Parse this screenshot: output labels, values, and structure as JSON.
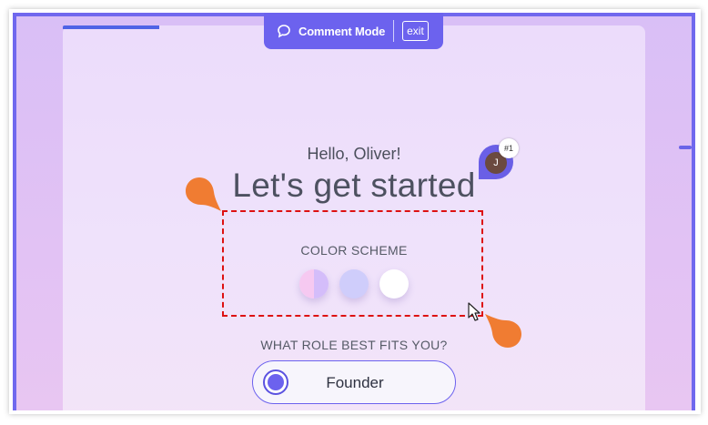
{
  "comment_bar": {
    "label": "Comment Mode",
    "exit_label": "exit",
    "icon": "comment-bubble-icon"
  },
  "onboarding": {
    "greeting": "Hello, Oliver!",
    "headline": "Let's get started",
    "color_scheme": {
      "label": "COLOR SCHEME",
      "options": [
        "pink-lavender",
        "periwinkle",
        "white"
      ]
    },
    "role": {
      "label": "WHAT ROLE BEST FITS YOU?",
      "selected_option": "Founder"
    }
  },
  "comment_pin": {
    "avatar_initial": "J",
    "number": "#1"
  },
  "colors": {
    "accent": "#6c62ee",
    "annotation_pin": "#f07c32",
    "selection_outline": "#dd1111"
  }
}
